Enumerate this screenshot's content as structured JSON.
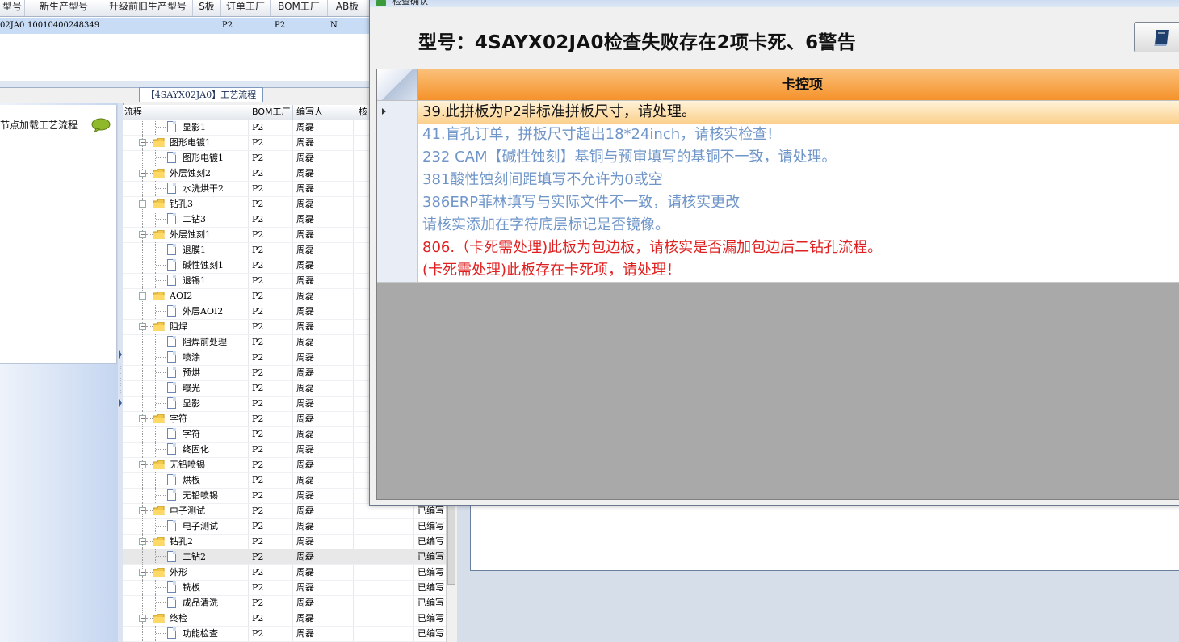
{
  "top_grid": {
    "headers": [
      "型号",
      "新生产型号",
      "升级前旧生产型号",
      "S板",
      "订单工厂",
      "BOM工厂",
      "AB板"
    ],
    "row": [
      "02JA0",
      "10010400248349",
      "",
      "",
      "P2",
      "P2",
      "N"
    ]
  },
  "flow_tab": "【4SAYX02JA0】工艺流程",
  "left_panel": {
    "label": "节点加载工艺流程"
  },
  "tree": {
    "headers": [
      "流程",
      "BOM工厂",
      "编写人",
      "核"
    ],
    "status_label": "已编写",
    "rows": [
      {
        "name": "显影1",
        "level": 2,
        "factory": "P2",
        "writer": "周磊"
      },
      {
        "name": "图形电镀1",
        "level": 1,
        "factory": "P2",
        "writer": "周磊"
      },
      {
        "name": "图形电镀1",
        "level": 2,
        "factory": "P2",
        "writer": "周磊"
      },
      {
        "name": "外层蚀刻2",
        "level": 1,
        "factory": "P2",
        "writer": "周磊"
      },
      {
        "name": "水洗烘干2",
        "level": 2,
        "factory": "P2",
        "writer": "周磊"
      },
      {
        "name": "钻孔3",
        "level": 1,
        "factory": "P2",
        "writer": "周磊"
      },
      {
        "name": "二钻3",
        "level": 2,
        "factory": "P2",
        "writer": "周磊"
      },
      {
        "name": "外层蚀刻1",
        "level": 1,
        "factory": "P2",
        "writer": "周磊"
      },
      {
        "name": "退膜1",
        "level": 2,
        "factory": "P2",
        "writer": "周磊"
      },
      {
        "name": "碱性蚀刻1",
        "level": 2,
        "factory": "P2",
        "writer": "周磊"
      },
      {
        "name": "退锡1",
        "level": 2,
        "factory": "P2",
        "writer": "周磊"
      },
      {
        "name": "AOI2",
        "level": 1,
        "factory": "P2",
        "writer": "周磊"
      },
      {
        "name": "外层AOI2",
        "level": 2,
        "factory": "P2",
        "writer": "周磊"
      },
      {
        "name": "阻焊",
        "level": 1,
        "factory": "P2",
        "writer": "周磊"
      },
      {
        "name": "阻焊前处理",
        "level": 2,
        "factory": "P2",
        "writer": "周磊"
      },
      {
        "name": "喷涂",
        "level": 2,
        "factory": "P2",
        "writer": "周磊"
      },
      {
        "name": "预烘",
        "level": 2,
        "factory": "P2",
        "writer": "周磊"
      },
      {
        "name": "曝光",
        "level": 2,
        "factory": "P2",
        "writer": "周磊"
      },
      {
        "name": "显影",
        "level": 2,
        "factory": "P2",
        "writer": "周磊"
      },
      {
        "name": "字符",
        "level": 1,
        "factory": "P2",
        "writer": "周磊"
      },
      {
        "name": "字符",
        "level": 2,
        "factory": "P2",
        "writer": "周磊"
      },
      {
        "name": "终固化",
        "level": 2,
        "factory": "P2",
        "writer": "周磊"
      },
      {
        "name": "无铅喷锡",
        "level": 1,
        "factory": "P2",
        "writer": "周磊"
      },
      {
        "name": "烘板",
        "level": 2,
        "factory": "P2",
        "writer": "周磊"
      },
      {
        "name": "无铅喷锡",
        "level": 2,
        "factory": "P2",
        "writer": "周磊"
      },
      {
        "name": "电子测试",
        "level": 1,
        "factory": "P2",
        "writer": "周磊",
        "status": true
      },
      {
        "name": "电子测试",
        "level": 2,
        "factory": "P2",
        "writer": "周磊",
        "status": true
      },
      {
        "name": "钻孔2",
        "level": 1,
        "factory": "P2",
        "writer": "周磊",
        "status": true
      },
      {
        "name": "二钻2",
        "level": 2,
        "factory": "P2",
        "writer": "周磊",
        "status": true,
        "selected": true
      },
      {
        "name": "外形",
        "level": 1,
        "factory": "P2",
        "writer": "周磊",
        "status": true
      },
      {
        "name": "铣板",
        "level": 2,
        "factory": "P2",
        "writer": "周磊",
        "status": true
      },
      {
        "name": "成品清洗",
        "level": 2,
        "factory": "P2",
        "writer": "周磊",
        "status": true
      },
      {
        "name": "终检",
        "level": 1,
        "factory": "P2",
        "writer": "周磊",
        "status": true
      },
      {
        "name": "功能检查",
        "level": 2,
        "factory": "P2",
        "writer": "周磊",
        "status": true
      }
    ]
  },
  "dialog": {
    "window_title": "检查确认",
    "heading": "型号：4SAYX02JA0检查失败存在2项卡死、6警告",
    "column_header": "卡控项",
    "items": [
      {
        "text": "39.此拼板为P2非标准拼板尺寸，请处理。",
        "color": "#111111",
        "active": true
      },
      {
        "text": "41.盲孔订单，拼板尺寸超出18*24inch，请核实检查!",
        "color": "#6f95c9"
      },
      {
        "text": "232 CAM【碱性蚀刻】基铜与预审填写的基铜不一致，请处理。",
        "color": "#6f95c9"
      },
      {
        "text": "381酸性蚀刻间距填写不允许为0或空",
        "color": "#6f95c9"
      },
      {
        "text": "386ERP菲林填写与实际文件不一致，请核实更改",
        "color": "#6f95c9"
      },
      {
        "text": "请核实添加在字符底层标记是否镜像。",
        "color": "#6f95c9"
      },
      {
        "text": "806.（卡死需处理)此板为包边板，请核实是否漏加包边后二钻孔流程。",
        "color": "#e02020"
      },
      {
        "text": "(卡死需处理)此板存在卡死项，请处理！",
        "color": "#e02020"
      }
    ],
    "book_icon": "book-icon"
  }
}
